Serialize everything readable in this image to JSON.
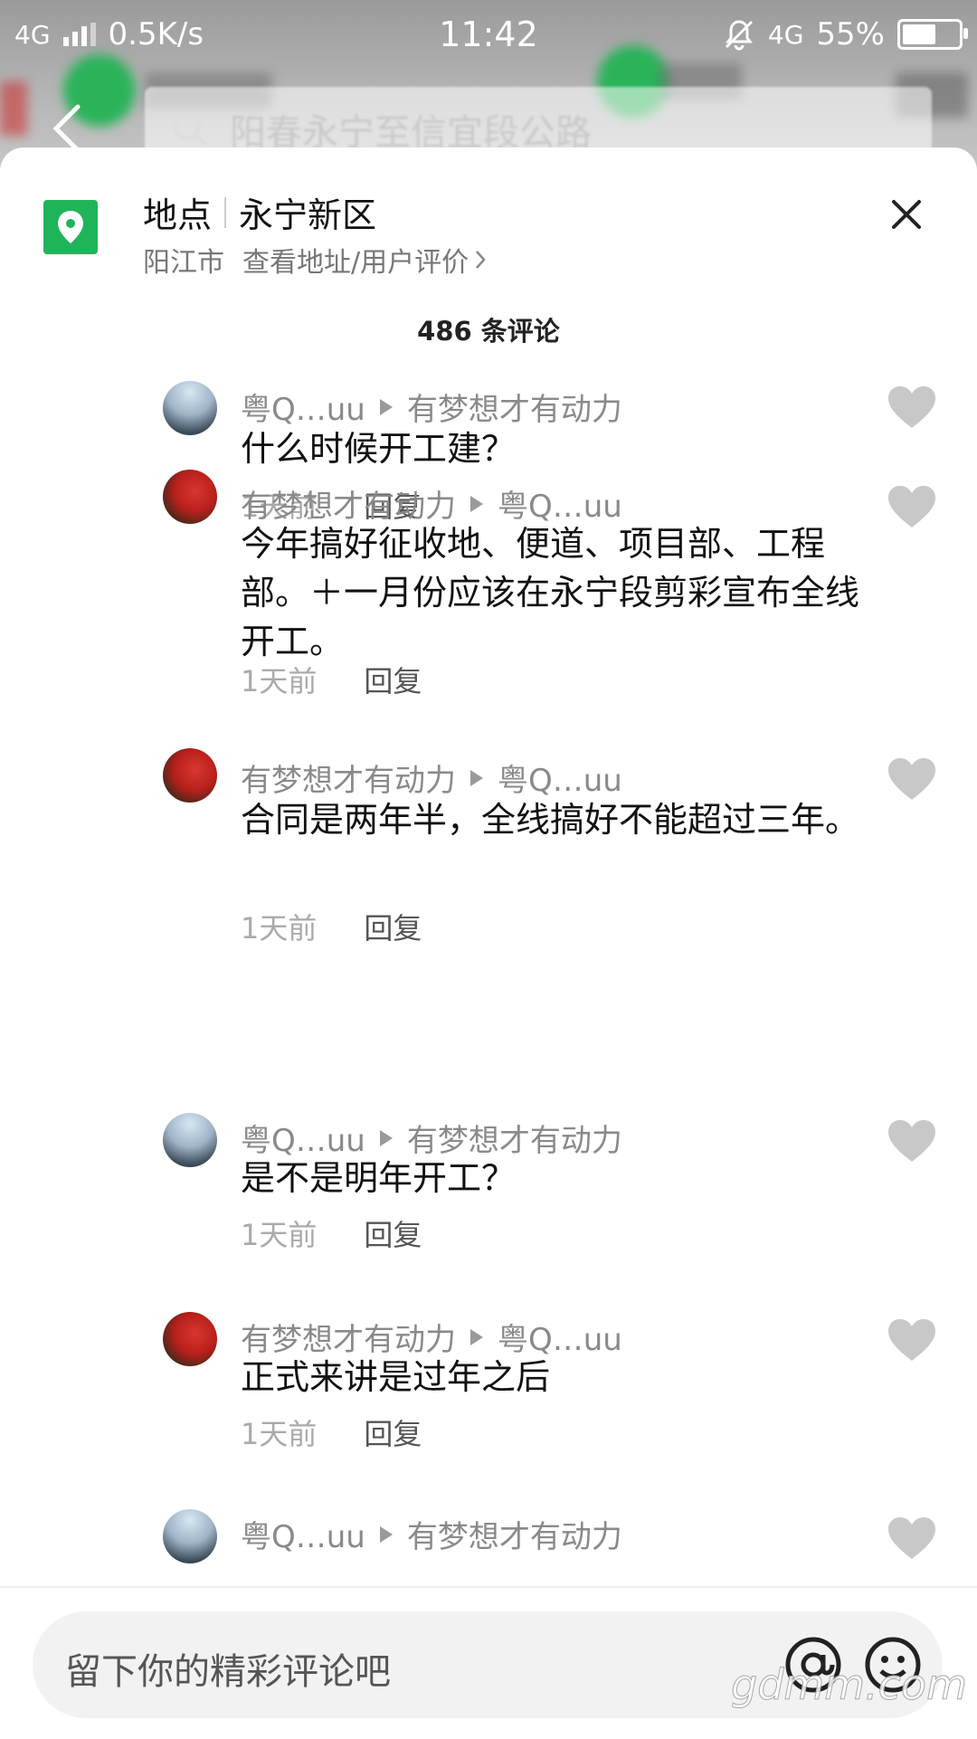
{
  "status_bar": {
    "network": "4G",
    "speed": "0.5K/s",
    "time": "11:42",
    "network_right": "4G",
    "battery": "55%",
    "battery_level": 0.55
  },
  "search": {
    "placeholder": "阳春永宁至信宜段公路"
  },
  "sheet": {
    "type_label": "地点",
    "place_name": "永宁新区",
    "city": "阳江市",
    "details_link": "查看地址/用户评价",
    "comment_count": "486 条评论"
  },
  "comments": [
    {
      "from": "粤Q…uu",
      "to": "有梦想才有动力",
      "text": "什么时候开工建？",
      "time": "1天前",
      "reply": "回复",
      "avatar": "mountain"
    },
    {
      "from": "有梦想才有动力",
      "to": "粤Q…uu",
      "text": "今年搞好征收地、便道、项目部、工程部。＋一月份应该在永宁段剪彩宣布全线开工。",
      "time": "1天前",
      "reply": "回复",
      "avatar": "red"
    },
    {
      "from": "有梦想才有动力",
      "to": "粤Q…uu",
      "text": "合同是两年半，全线搞好不能超过三年。",
      "time": "1天前",
      "reply": "回复",
      "avatar": "red"
    },
    {
      "from": "粤Q…uu",
      "to": "有梦想才有动力",
      "text": "是不是明年开工？",
      "time": "1天前",
      "reply": "回复",
      "avatar": "mountain"
    },
    {
      "from": "有梦想才有动力",
      "to": "粤Q…uu",
      "text": "正式来讲是过年之后",
      "time": "1天前",
      "reply": "回复",
      "avatar": "red"
    },
    {
      "from": "粤Q…uu",
      "to": "有梦想才有动力",
      "text": "",
      "time": "",
      "reply": "",
      "avatar": "mountain"
    }
  ],
  "input": {
    "placeholder": "留下你的精彩评论吧"
  },
  "watermark": "gdmm.com",
  "colors": {
    "accent_green": "#20b45a",
    "heart_gray": "#c8c8c8"
  }
}
